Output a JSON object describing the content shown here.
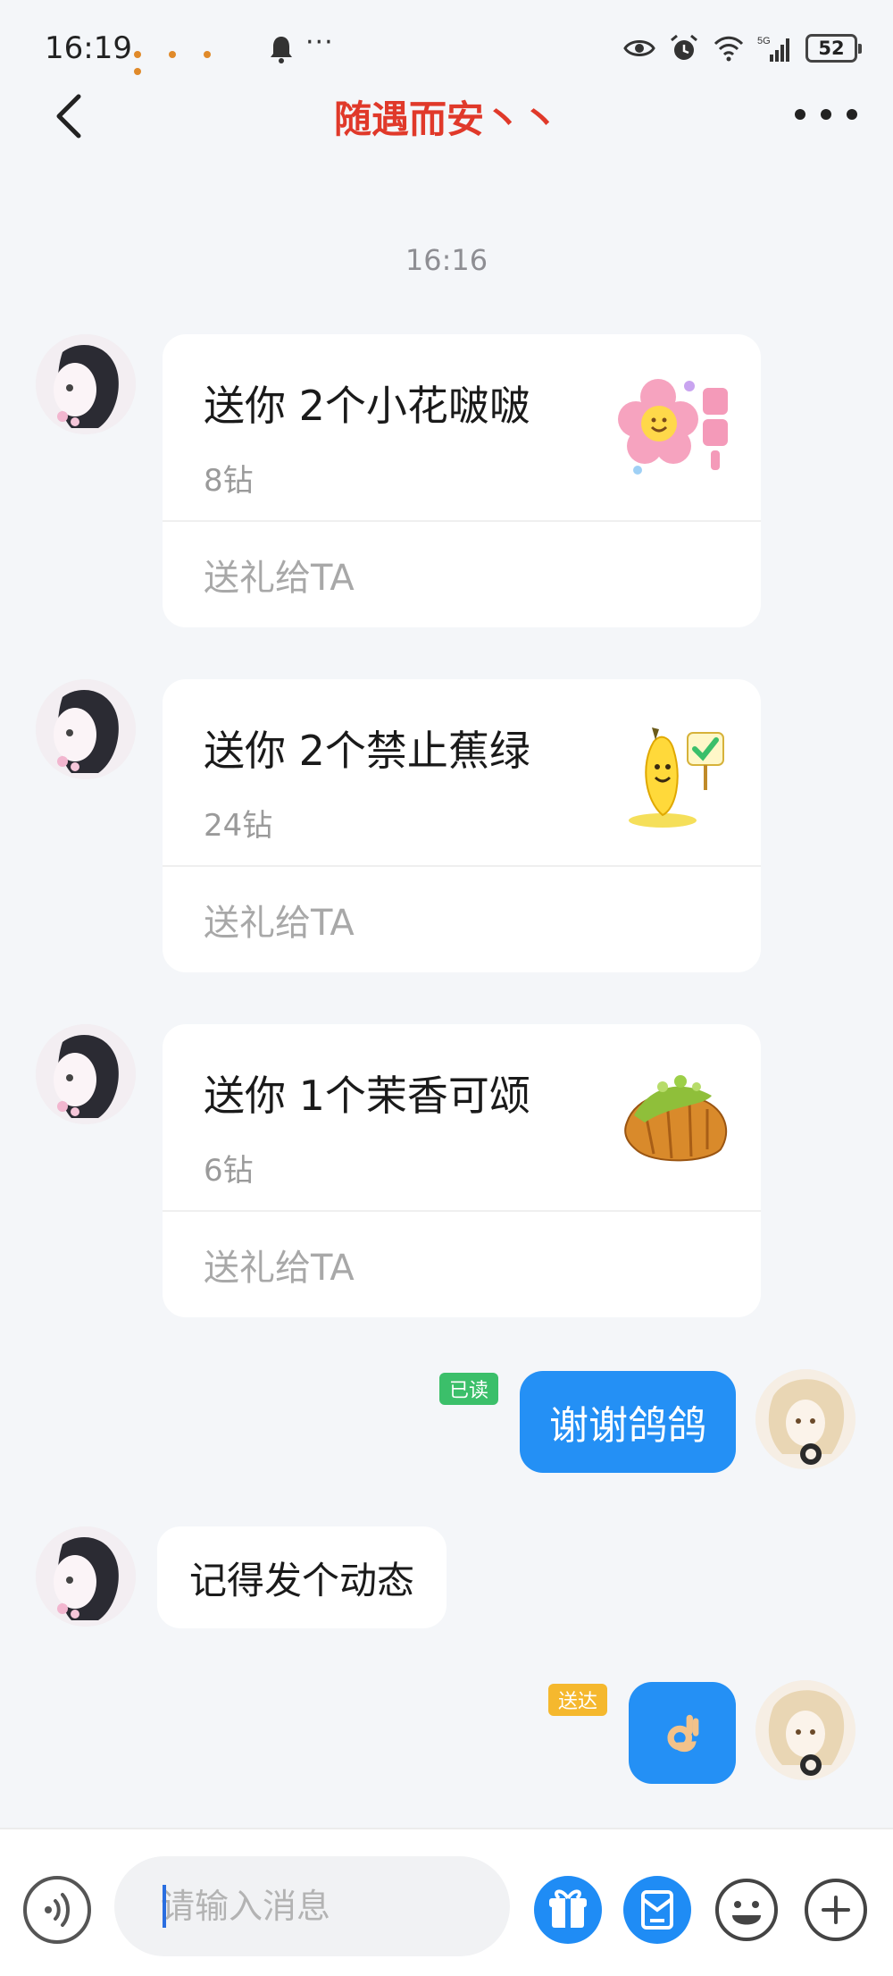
{
  "status_bar": {
    "time": "16:19",
    "network": "5G",
    "battery": "52"
  },
  "header": {
    "title": "随遇而安丶丶"
  },
  "chat": {
    "timestamp": "16:16",
    "gifts": [
      {
        "title": "送你 2个小花啵啵",
        "price": "8钻",
        "action": "送礼给TA"
      },
      {
        "title": "送你 2个禁止蕉绿",
        "price": "24钻",
        "action": "送礼给TA"
      },
      {
        "title": "送你 1个茉香可颂",
        "price": "6钻",
        "action": "送礼给TA"
      }
    ],
    "out_message_1": {
      "text": "谢谢鸽鸽",
      "status": "已读"
    },
    "in_message_1": {
      "text": "记得发个动态"
    },
    "out_message_2": {
      "text": "👌",
      "status": "送达"
    }
  },
  "input_bar": {
    "placeholder": "请输入消息"
  },
  "colors": {
    "title_red": "#e0392a",
    "bubble_blue": "#2490f5",
    "read_green": "#3bbf6a",
    "delivered_orange": "#f5b82e",
    "gift_red": "#ef4036",
    "letter_blue": "#1f8cf5"
  }
}
